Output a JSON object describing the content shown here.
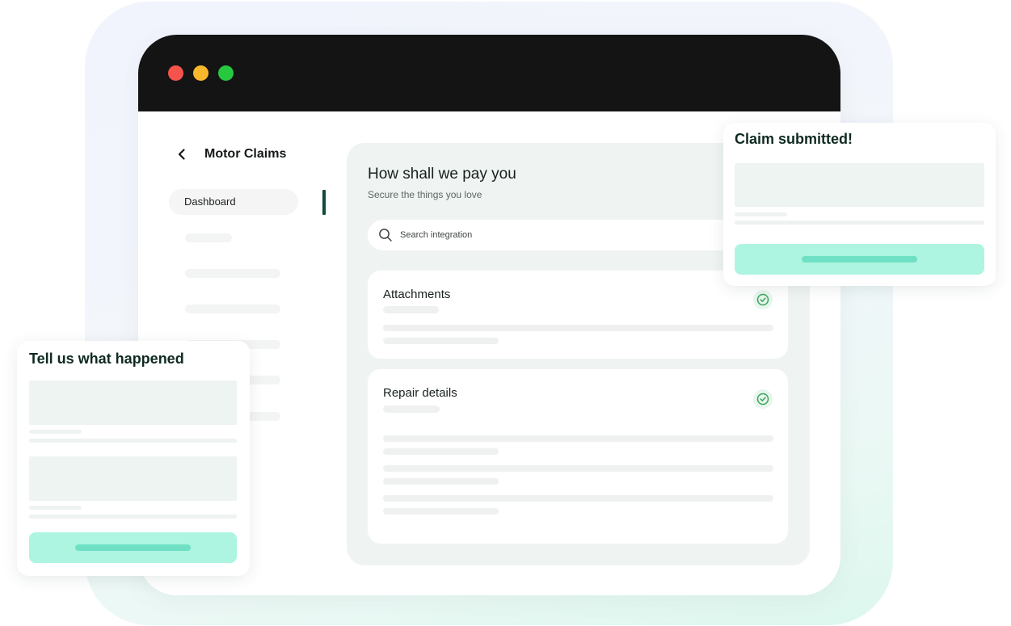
{
  "window": {
    "title": "Motor Claims",
    "nav": {
      "active_item": "Dashboard"
    }
  },
  "payment_panel": {
    "title": "How shall we pay you",
    "subtitle": "Secure the things you love",
    "search": {
      "placeholder": "Search integration",
      "value": ""
    },
    "cards": [
      {
        "title": "Attachments",
        "status_icon": "check-circle-icon"
      },
      {
        "title": "Repair details",
        "status_icon": "check-circle-icon"
      }
    ]
  },
  "toast_right": {
    "title": "Claim submitted!"
  },
  "toast_left": {
    "title": "Tell us what happened"
  },
  "colors": {
    "accent_mint": "#adf5e0",
    "accent_mint_dark": "#6fe0c4",
    "nav_indicator": "#0f4a3b",
    "titlebar": "#141414",
    "check_green": "#3aa35a"
  }
}
